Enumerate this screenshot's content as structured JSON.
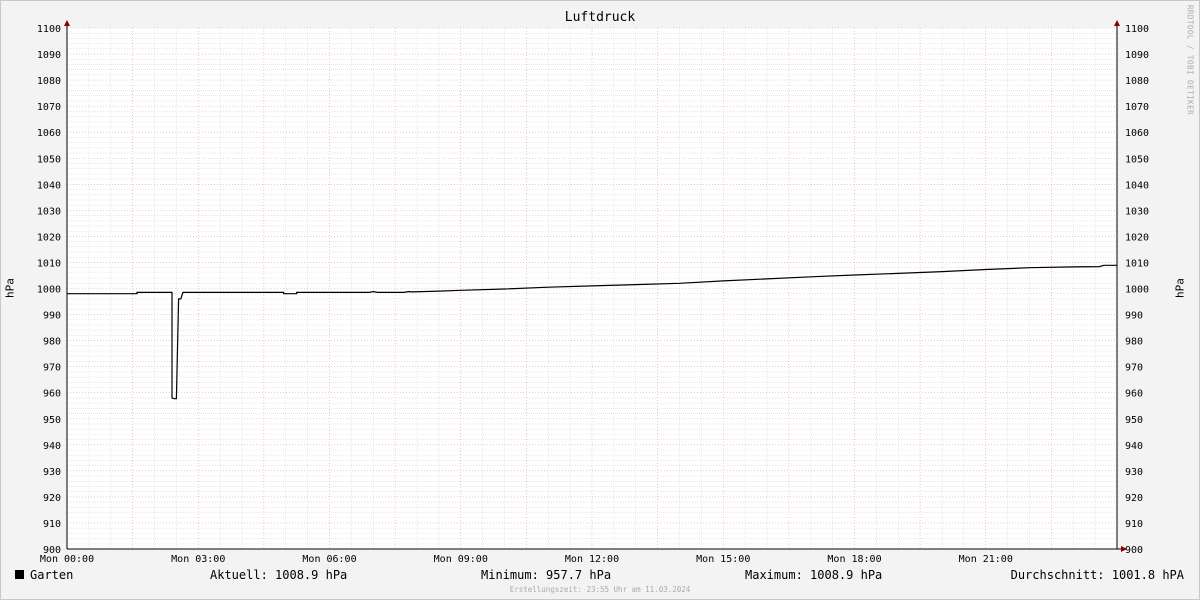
{
  "chart_data": {
    "type": "line",
    "title": "Luftdruck",
    "ylabel": "hPa",
    "ylim": [
      900,
      1100
    ],
    "y_ticks": [
      900,
      910,
      920,
      930,
      940,
      950,
      960,
      970,
      980,
      990,
      1000,
      1010,
      1020,
      1030,
      1040,
      1050,
      1060,
      1070,
      1080,
      1090,
      1100
    ],
    "x_ticks": [
      "Mon 00:00",
      "Mon 03:00",
      "Mon 06:00",
      "Mon 09:00",
      "Mon 12:00",
      "Mon 15:00",
      "Mon 18:00",
      "Mon 21:00"
    ],
    "x_range_hours": [
      0,
      24
    ],
    "grid": true,
    "series": [
      {
        "name": "Garten",
        "color": "#000000",
        "points": [
          [
            0.0,
            998.0
          ],
          [
            1.6,
            998.0
          ],
          [
            1.6,
            998.5
          ],
          [
            2.4,
            998.5
          ],
          [
            2.4,
            958.0
          ],
          [
            2.45,
            957.7
          ],
          [
            2.5,
            957.7
          ],
          [
            2.55,
            996.0
          ],
          [
            2.6,
            996.0
          ],
          [
            2.65,
            998.5
          ],
          [
            4.95,
            998.5
          ],
          [
            4.95,
            998.0
          ],
          [
            5.25,
            998.0
          ],
          [
            5.25,
            998.5
          ],
          [
            6.9,
            998.5
          ],
          [
            7.0,
            998.8
          ],
          [
            7.1,
            998.5
          ],
          [
            7.7,
            998.5
          ],
          [
            7.8,
            998.8
          ],
          [
            7.9,
            998.7
          ],
          [
            8.5,
            999.0
          ],
          [
            9.0,
            999.3
          ],
          [
            10.0,
            999.8
          ],
          [
            11.0,
            1000.5
          ],
          [
            12.0,
            1001.0
          ],
          [
            13.0,
            1001.5
          ],
          [
            14.0,
            1002.0
          ],
          [
            15.0,
            1002.9
          ],
          [
            16.0,
            1003.7
          ],
          [
            17.0,
            1004.5
          ],
          [
            18.0,
            1005.2
          ],
          [
            19.0,
            1005.8
          ],
          [
            20.0,
            1006.5
          ],
          [
            21.0,
            1007.3
          ],
          [
            22.0,
            1008.0
          ],
          [
            23.0,
            1008.3
          ],
          [
            23.6,
            1008.4
          ],
          [
            23.7,
            1008.9
          ],
          [
            24.0,
            1008.9
          ]
        ]
      }
    ]
  },
  "watermark": "RRDTOOL / TOBI OETIKER",
  "legend": {
    "series_name": "Garten",
    "aktuell": "Aktuell: 1008.9 hPa",
    "minimum": "Minimum: 957.7 hPa",
    "maximum": "Maximum: 1008.9 hPa",
    "durchschnitt": "Durchschnitt: 1001.8 hPA"
  },
  "footer": "Erstellungszeit: 23:55 Uhr am 11.03.2024"
}
